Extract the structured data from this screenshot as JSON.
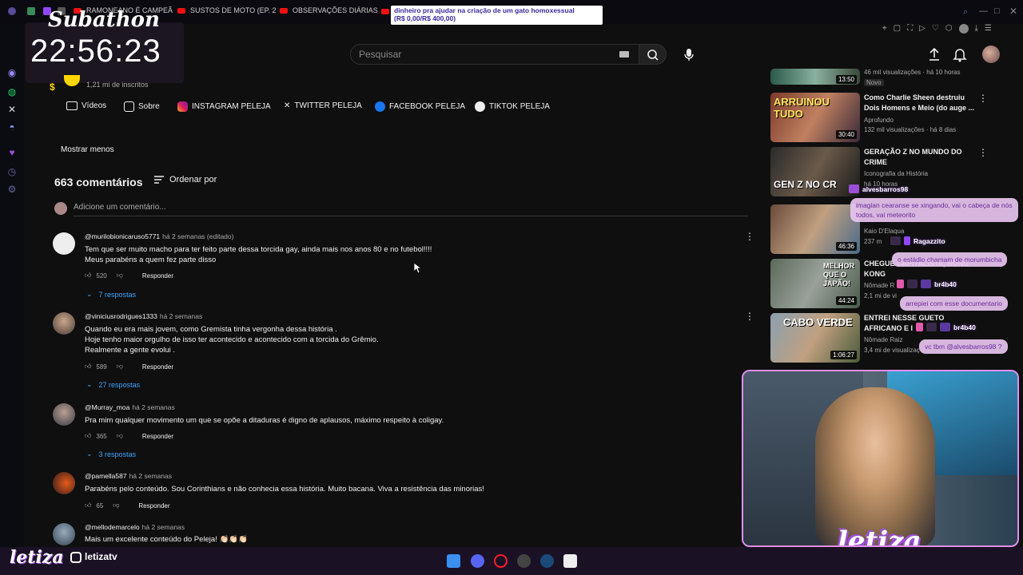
{
  "browser": {
    "tabs": [
      {
        "label": "RAMONEANO É CAMPEÃ"
      },
      {
        "label": "SUSTOS DE MOTO (EP. 2"
      },
      {
        "label": "OBSERVAÇÕES DIÁRIAS"
      }
    ],
    "donation_alert": {
      "line1": "dinheiro pra ajudar na criação de um gato homoxessual",
      "line2": "(R$ 0,00/R$ 400,00)",
      "progress_fraction": 0.0
    }
  },
  "overlay": {
    "subathon_title": "Subathon",
    "timer": "22:56:23",
    "streamer_logo": "letiza",
    "social_handle": "letizatv",
    "webcam_logo": "letiza"
  },
  "search": {
    "placeholder": "Pesquisar"
  },
  "channel": {
    "subscribers": "1,21 mi de inscritos",
    "tabs": [
      {
        "label": "Vídeos",
        "icon": "video-icon"
      },
      {
        "label": "Sobre",
        "icon": "about-icon"
      },
      {
        "label": "INSTAGRAM PELEJA",
        "icon": "instagram-icon"
      },
      {
        "label": "TWITTER PELEJA",
        "icon": "x-icon"
      },
      {
        "label": "FACEBOOK PELEJA",
        "icon": "facebook-icon"
      },
      {
        "label": "TIKTOK PELEJA",
        "icon": "tiktok-icon"
      }
    ],
    "show_less": "Mostrar menos"
  },
  "comments": {
    "count_label": "663 comentários",
    "sort_label": "Ordenar por",
    "add_placeholder": "Adicione um comentário...",
    "items": [
      {
        "author": "@murilobionicaruso5771",
        "time": "há 2 semanas (editado)",
        "lines": [
          "Tem que ser muito macho para ter feito parte dessa torcida gay, ainda mais nos anos 80 e no futebol!!!!",
          "Meus parabéns a quem fez parte disso"
        ],
        "likes": "520",
        "reply": "Responder",
        "replies": "7 respostas"
      },
      {
        "author": "@viniciusrodrigues1333",
        "time": "há 2 semanas",
        "lines": [
          "Quando eu era mais jovem, como Gremista tinha vergonha dessa história .",
          "Hoje tenho maior orgulho de isso ter acontecido e acontecido com a torcida do Grêmio.",
          "Realmente a gente evolui ."
        ],
        "likes": "589",
        "reply": "Responder",
        "replies": "27 respostas"
      },
      {
        "author": "@Murray_moa",
        "time": "há 2 semanas",
        "lines": [
          "Pra mim qualquer movimento um que se opõe a ditaduras é digno de aplausos, máximo respeito à coligay."
        ],
        "likes": "365",
        "reply": "Responder",
        "replies": "3 respostas"
      },
      {
        "author": "@pamella587",
        "time": "há 2 semanas",
        "lines": [
          "Parabéns pelo conteúdo. Sou Corinthians e não conhecia essa história. Muito bacana. Viva a resistência das minorias!"
        ],
        "likes": "65",
        "reply": "Responder",
        "replies": ""
      },
      {
        "author": "@mellodemarcelo",
        "time": "há 2 semanas",
        "lines": [
          "Mais um excelente conteúdo do Peleja! 👏🏻👏🏻👏🏻"
        ],
        "likes": "",
        "reply": "",
        "replies": ""
      }
    ]
  },
  "recommended": [
    {
      "title": "",
      "channel": "",
      "meta": "46 mil visualizações · há 10 horas",
      "badge": "Novo",
      "duration": "13:50",
      "thumb_text": ""
    },
    {
      "title": "Como Charlie Sheen destruiu Dois Homens e Meio (do auge ...",
      "channel": "Aprofundo",
      "meta": "132 mil visualizações · há 8 dias",
      "duration": "30:40",
      "thumb_text": "ARRUINOU TUDO"
    },
    {
      "title": "GERAÇÃO Z NO MUNDO DO CRIME",
      "channel": "Iconografia da História",
      "meta": "há 10 horas",
      "duration": "",
      "thumb_text": "GEN Z NO CR"
    },
    {
      "title": "",
      "channel": "Kaio D'Elaqua",
      "meta": "237 m",
      "duration": "46:36",
      "thumb_text": ""
    },
    {
      "title": "CHEGUE CAPITALISTA, HONG KONG",
      "channel": "Nômade R",
      "meta": "2,1 mi de vi",
      "duration": "44:24",
      "thumb_text": "MELHOR QUE O JAPÃO!"
    },
    {
      "title": "ENTREI NESSE GUETO AFRICANO E I",
      "channel": "Nômade Raiz",
      "meta": "3,4 mi de visualizaç",
      "duration": "1:06:27",
      "thumb_text": "CABO VERDE"
    }
  ],
  "chat": [
    {
      "user": "alvesbarros98",
      "message": "imagian cearanse se xingando, vai o cabeça de nós todos, vai meteorito"
    },
    {
      "user": "Ragazzito",
      "message": "o estádio chamam de morumbicha"
    },
    {
      "user": "br4b40",
      "message": "arrepiei com esse documentario"
    },
    {
      "user": "br4b40",
      "message": "vc tbm @alvesbarros98 ?"
    }
  ],
  "colors": {
    "background": "#0f0f0f",
    "link_blue": "#3ea6ff",
    "chat_bubble": "#e8c4f0",
    "accent_purple": "#9b4fd6"
  }
}
